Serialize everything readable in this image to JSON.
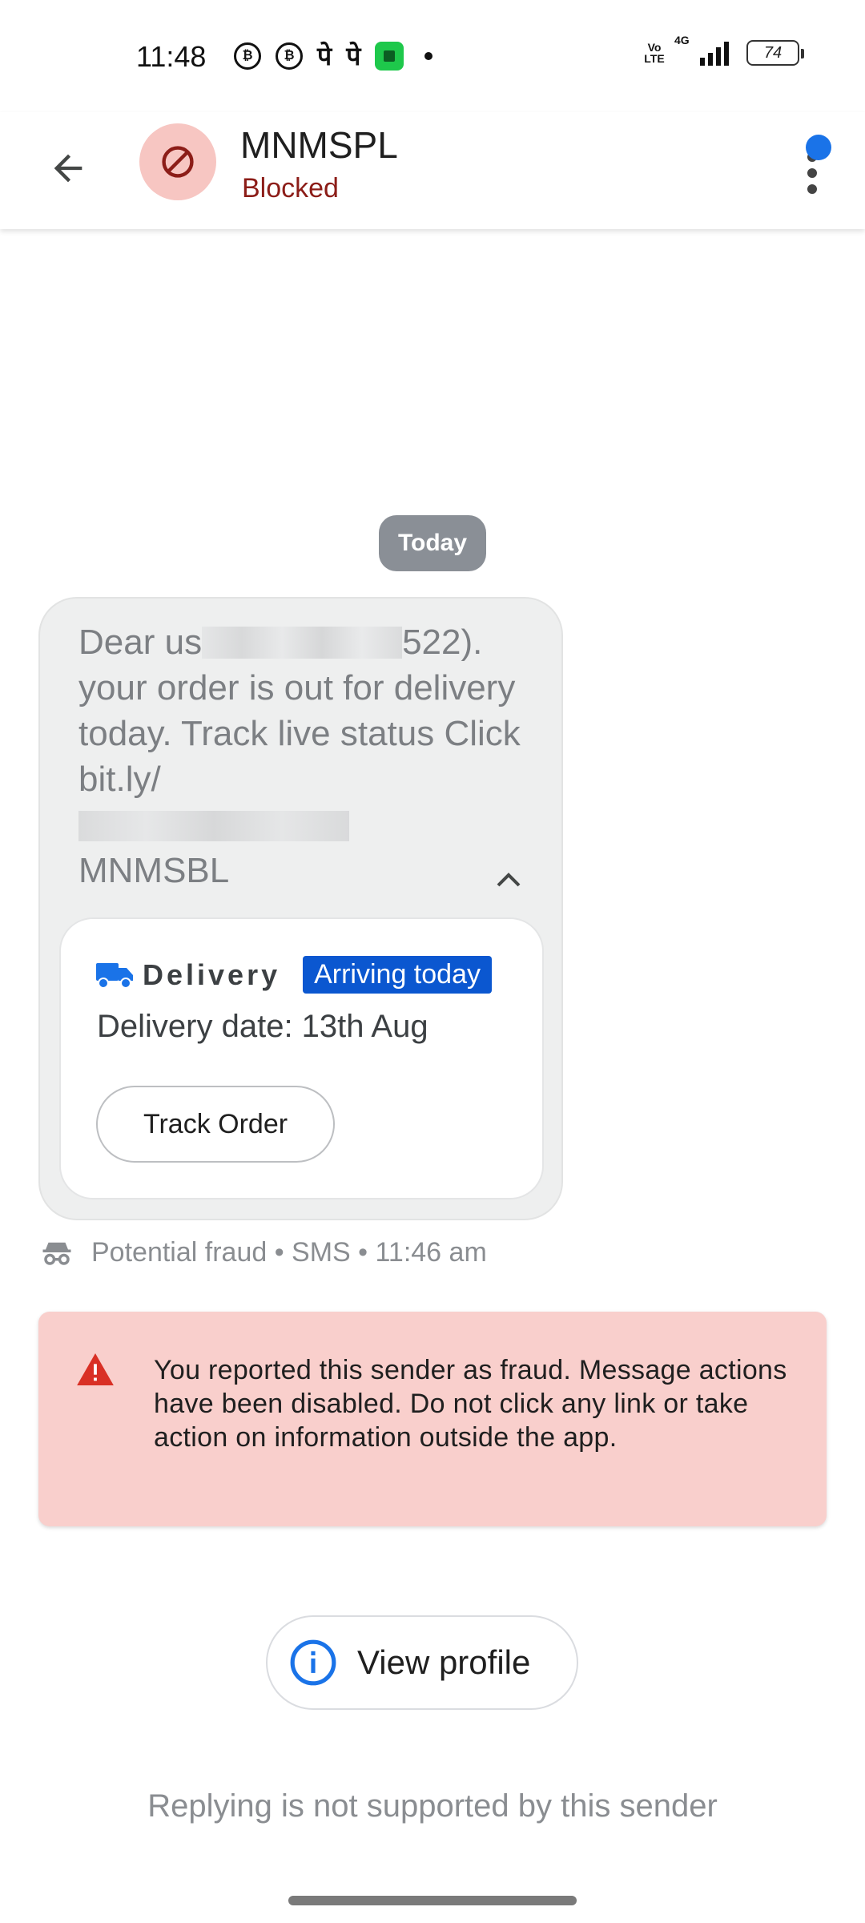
{
  "status_bar": {
    "time": "11:48",
    "notification_pe_1": "पे",
    "notification_pe_2": "पे",
    "coin_label": "₿",
    "volte": "Vo LTE",
    "network": "4G",
    "battery": "74"
  },
  "header": {
    "sender_name": "MNMSPL",
    "sender_status": "Blocked",
    "status_color": "#8c1d18",
    "avatar_color": "#f7c6c2"
  },
  "conversation": {
    "date_chip": "Today",
    "message": {
      "text_start": "Dear us",
      "text_after_redaction": "522). your order is out for delivery today. Track live status Click bit.ly/",
      "sender_code": "MNMSBL"
    },
    "delivery_card": {
      "title": "Delivery",
      "badge": "Arriving today",
      "badge_color": "#0b57d0",
      "delivery_date": "Delivery date: 13th Aug",
      "track_button": "Track Order"
    },
    "meta": "Potential fraud • SMS • 11:46 am"
  },
  "warning": {
    "text": "You reported this sender as fraud. Message actions have been disabled. Do not click any link or take action on information outside the app.",
    "background": "#f9cfcc",
    "icon_color": "#d93025"
  },
  "profile_button": {
    "label": "View profile"
  },
  "reply_note": "Replying is not supported by this sender",
  "icons": [
    "back-arrow-icon",
    "block-icon",
    "more-vert-icon",
    "truck-icon",
    "chevron-up-icon",
    "spy-icon",
    "warning-icon",
    "info-icon"
  ]
}
